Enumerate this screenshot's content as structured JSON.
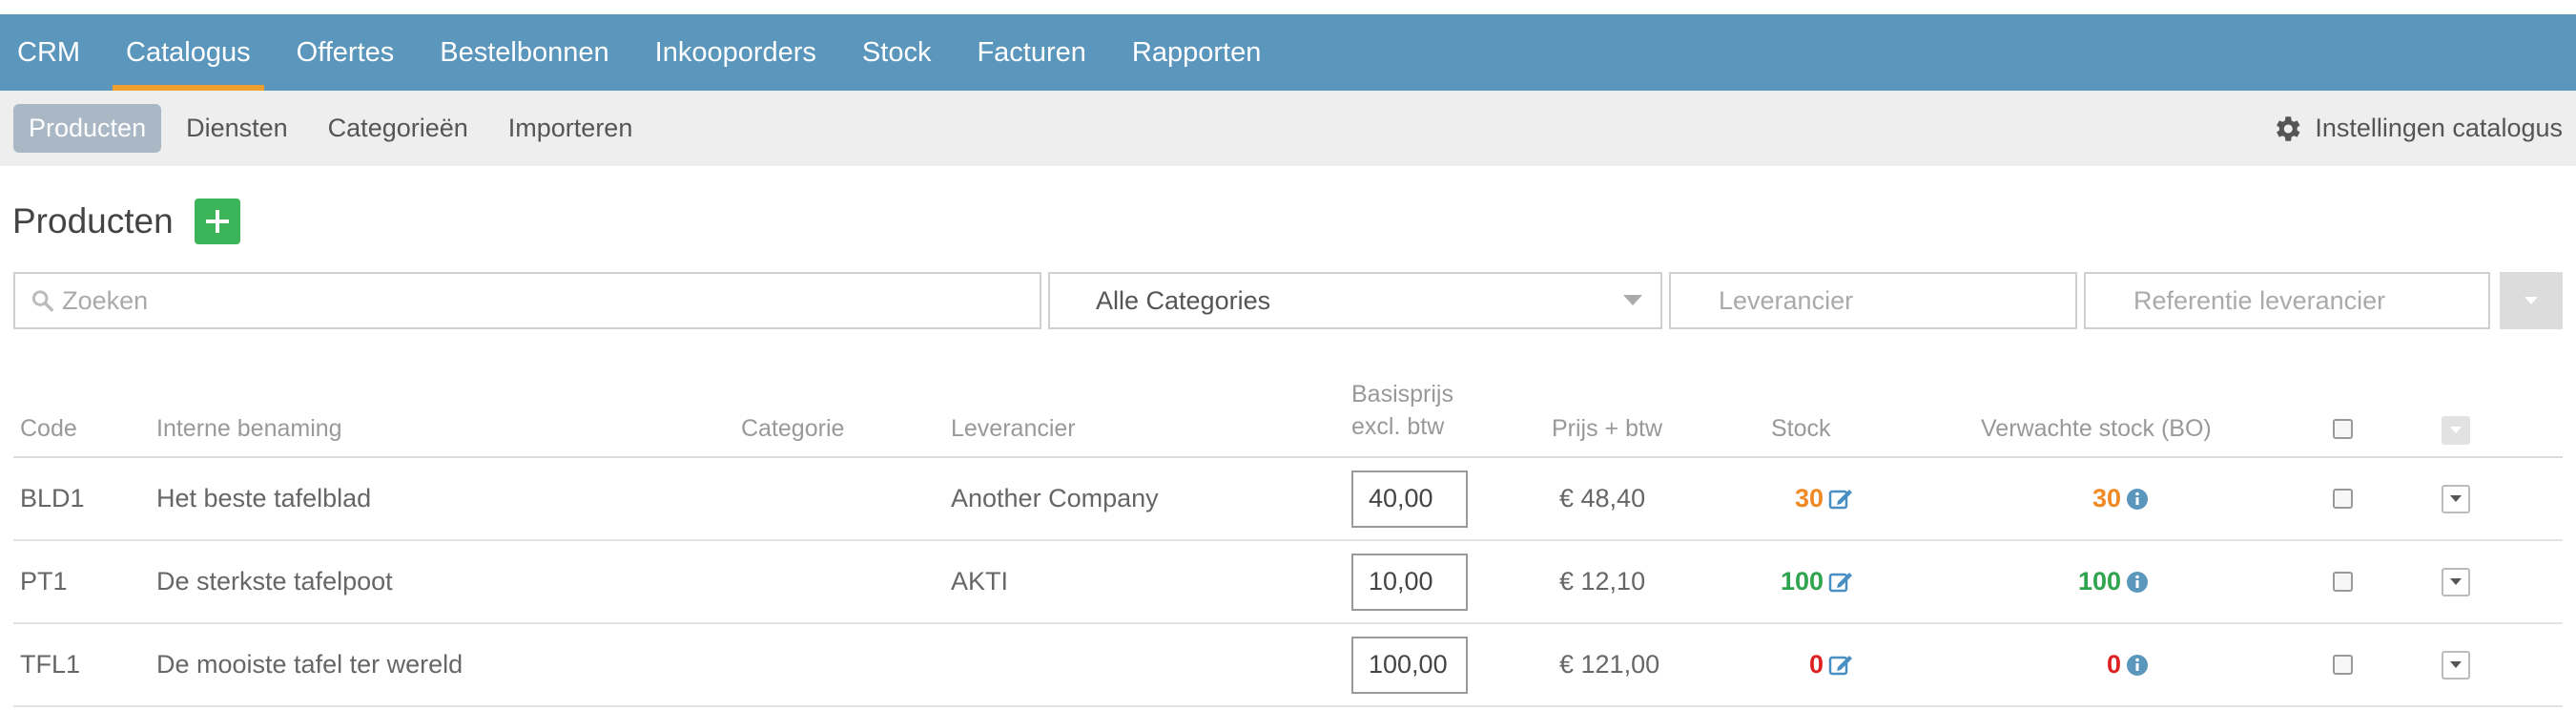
{
  "colors": {
    "nav_bg": "#5b96bc",
    "active_underline": "#f0a030",
    "add_button": "#3cb55a",
    "orange": "#f08a24",
    "green": "#2ea44f",
    "red": "#e02020",
    "info_blue": "#5b96bc"
  },
  "nav": {
    "items": [
      {
        "label": "CRM",
        "active": false
      },
      {
        "label": "Catalogus",
        "active": true
      },
      {
        "label": "Offertes",
        "active": false
      },
      {
        "label": "Bestelbonnen",
        "active": false
      },
      {
        "label": "Inkooporders",
        "active": false
      },
      {
        "label": "Stock",
        "active": false
      },
      {
        "label": "Facturen",
        "active": false
      },
      {
        "label": "Rapporten",
        "active": false
      }
    ]
  },
  "subnav": {
    "items": [
      {
        "label": "Producten",
        "active": true
      },
      {
        "label": "Diensten",
        "active": false
      },
      {
        "label": "Categorieën",
        "active": false
      },
      {
        "label": "Importeren",
        "active": false
      }
    ],
    "settings_label": "Instellingen catalogus",
    "settings_icon": "gear-icon"
  },
  "page": {
    "title": "Producten",
    "add_icon": "plus-icon"
  },
  "filters": {
    "search_placeholder": "Zoeken",
    "category_selected": "Alle Categories",
    "supplier_placeholder": "Leverancier",
    "supplier_ref_placeholder": "Referentie leverancier"
  },
  "table": {
    "headers": {
      "code": "Code",
      "name": "Interne benaming",
      "category": "Categorie",
      "supplier": "Leverancier",
      "base_price_1": "Basisprijs",
      "base_price_2": "excl. btw",
      "price_vat": "Prijs + btw",
      "stock": "Stock",
      "expected_stock": "Verwachte stock (BO)"
    },
    "rows": [
      {
        "code": "BLD1",
        "name": "Het beste tafelblad",
        "category": "",
        "supplier": "Another Company",
        "base_price": "40,00",
        "price_vat": "€ 48,40",
        "stock": "30",
        "expected_stock": "30",
        "status": "orange"
      },
      {
        "code": "PT1",
        "name": "De sterkste tafelpoot",
        "category": "",
        "supplier": "AKTI",
        "base_price": "10,00",
        "price_vat": "€ 12,10",
        "stock": "100",
        "expected_stock": "100",
        "status": "green"
      },
      {
        "code": "TFL1",
        "name": "De mooiste tafel ter wereld",
        "category": "",
        "supplier": "",
        "base_price": "100,00",
        "price_vat": "€ 121,00",
        "stock": "0",
        "expected_stock": "0",
        "status": "red"
      }
    ]
  }
}
